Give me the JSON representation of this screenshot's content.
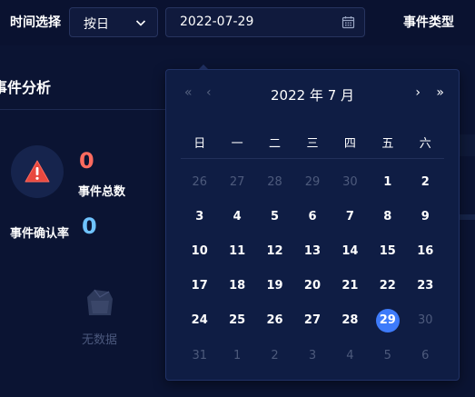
{
  "toolbar": {
    "time_label": "时间选择",
    "granularity_value": "按日",
    "date_value": "2022-07-29",
    "event_type_label": "事件类型"
  },
  "panel": {
    "title": "事件分析",
    "total_count": "0",
    "total_label": "事件总数",
    "confirm_rate_label": "事件确认率",
    "confirm_rate_value": "0",
    "empty_text": "无数据"
  },
  "calendar": {
    "nav_prev_year": "«",
    "nav_prev_month": "‹",
    "nav_next_month": "›",
    "nav_next_year": "»",
    "title": "2022 年  7 月",
    "weekdays": [
      "日",
      "一",
      "二",
      "三",
      "四",
      "五",
      "六"
    ],
    "days": [
      {
        "label": "26",
        "muted": true
      },
      {
        "label": "27",
        "muted": true
      },
      {
        "label": "28",
        "muted": true
      },
      {
        "label": "29",
        "muted": true
      },
      {
        "label": "30",
        "muted": true
      },
      {
        "label": "1",
        "muted": false
      },
      {
        "label": "2",
        "muted": false
      },
      {
        "label": "3",
        "muted": false
      },
      {
        "label": "4",
        "muted": false
      },
      {
        "label": "5",
        "muted": false
      },
      {
        "label": "6",
        "muted": false
      },
      {
        "label": "7",
        "muted": false
      },
      {
        "label": "8",
        "muted": false
      },
      {
        "label": "9",
        "muted": false
      },
      {
        "label": "10",
        "muted": false
      },
      {
        "label": "11",
        "muted": false
      },
      {
        "label": "12",
        "muted": false
      },
      {
        "label": "13",
        "muted": false
      },
      {
        "label": "14",
        "muted": false
      },
      {
        "label": "15",
        "muted": false
      },
      {
        "label": "16",
        "muted": false
      },
      {
        "label": "17",
        "muted": false
      },
      {
        "label": "18",
        "muted": false
      },
      {
        "label": "19",
        "muted": false
      },
      {
        "label": "20",
        "muted": false
      },
      {
        "label": "21",
        "muted": false
      },
      {
        "label": "22",
        "muted": false
      },
      {
        "label": "23",
        "muted": false
      },
      {
        "label": "24",
        "muted": false
      },
      {
        "label": "25",
        "muted": false
      },
      {
        "label": "26",
        "muted": false
      },
      {
        "label": "27",
        "muted": false
      },
      {
        "label": "28",
        "muted": false
      },
      {
        "label": "29",
        "muted": false,
        "selected": true
      },
      {
        "label": "30",
        "muted": true
      },
      {
        "label": "31",
        "muted": true
      },
      {
        "label": "1",
        "muted": true
      },
      {
        "label": "2",
        "muted": true
      },
      {
        "label": "3",
        "muted": true
      },
      {
        "label": "4",
        "muted": true
      },
      {
        "label": "5",
        "muted": true
      },
      {
        "label": "6",
        "muted": true
      }
    ],
    "selected_color": "#3e7bfa"
  },
  "colors": {
    "background": "#0b1433",
    "total_count": "#ff6b5f",
    "confirm_rate": "#6fc3ff",
    "warning_icon": "#e8483f"
  },
  "icons": {
    "granularity_select": "chevron-down-icon",
    "date_input": "calendar-icon",
    "alert": "warning-icon",
    "empty_state": "empty-box-icon"
  }
}
